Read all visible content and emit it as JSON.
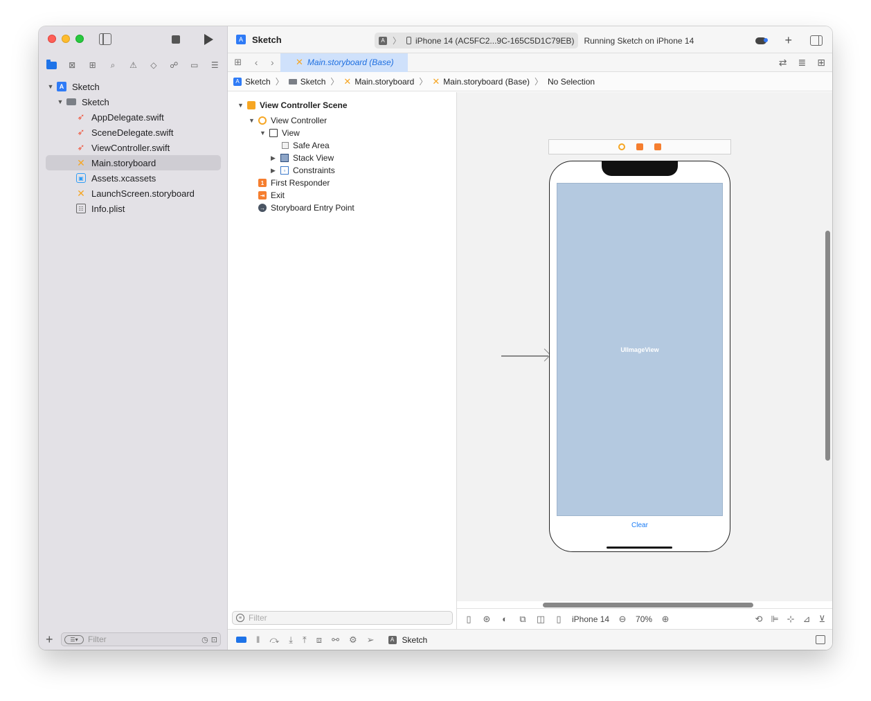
{
  "colors": {
    "accent": "#1e73e8",
    "selection_bg": "#cfcdd3",
    "tab_bg": "#cfe1fb",
    "image_view_bg": "#b4c9e0",
    "swift_orange": "#f05138",
    "storyboard_yellow": "#f6a623"
  },
  "navigator": {
    "tabs": [
      "folder-icon",
      "source-control-icon",
      "symbol-icon",
      "search-icon",
      "warning-icon",
      "test-icon",
      "debug-icon",
      "breakpoint-icon",
      "report-icon"
    ],
    "tree": [
      {
        "label": "Sketch",
        "depth": 0,
        "icon": "project-icon",
        "expanded": true
      },
      {
        "label": "Sketch",
        "depth": 1,
        "icon": "folder-icon",
        "expanded": true
      },
      {
        "label": "AppDelegate.swift",
        "depth": 2,
        "icon": "swift-file-icon"
      },
      {
        "label": "SceneDelegate.swift",
        "depth": 2,
        "icon": "swift-file-icon"
      },
      {
        "label": "ViewController.swift",
        "depth": 2,
        "icon": "swift-file-icon"
      },
      {
        "label": "Main.storyboard",
        "depth": 2,
        "icon": "storyboard-icon",
        "selected": true
      },
      {
        "label": "Assets.xcassets",
        "depth": 2,
        "icon": "assets-icon"
      },
      {
        "label": "LaunchScreen.storyboard",
        "depth": 2,
        "icon": "storyboard-icon"
      },
      {
        "label": "Info.plist",
        "depth": 2,
        "icon": "plist-icon"
      }
    ],
    "filter_placeholder": "Filter"
  },
  "toolbar": {
    "title": "Sketch",
    "device": "iPhone 14 (AC5FC2...9C-165C5D1C79EB)",
    "status": "Running Sketch on iPhone 14"
  },
  "editor_tab": {
    "label": "Main.storyboard (Base)"
  },
  "jumpbar": {
    "crumbs": [
      "Sketch",
      "Sketch",
      "Main.storyboard",
      "Main.storyboard (Base)",
      "No Selection"
    ]
  },
  "outline": {
    "rows": [
      {
        "label": "View Controller Scene",
        "bold": true
      },
      {
        "label": "View Controller"
      },
      {
        "label": "View"
      },
      {
        "label": "Safe Area"
      },
      {
        "label": "Stack View"
      },
      {
        "label": "Constraints"
      },
      {
        "label": "First Responder"
      },
      {
        "label": "Exit"
      },
      {
        "label": "Storyboard Entry Point"
      }
    ],
    "filter_placeholder": "Filter"
  },
  "canvas": {
    "image_view_label": "UIImageView",
    "button_label": "Clear",
    "device": "iPhone 14",
    "zoom": "70%"
  },
  "debug": {
    "target": "Sketch"
  }
}
